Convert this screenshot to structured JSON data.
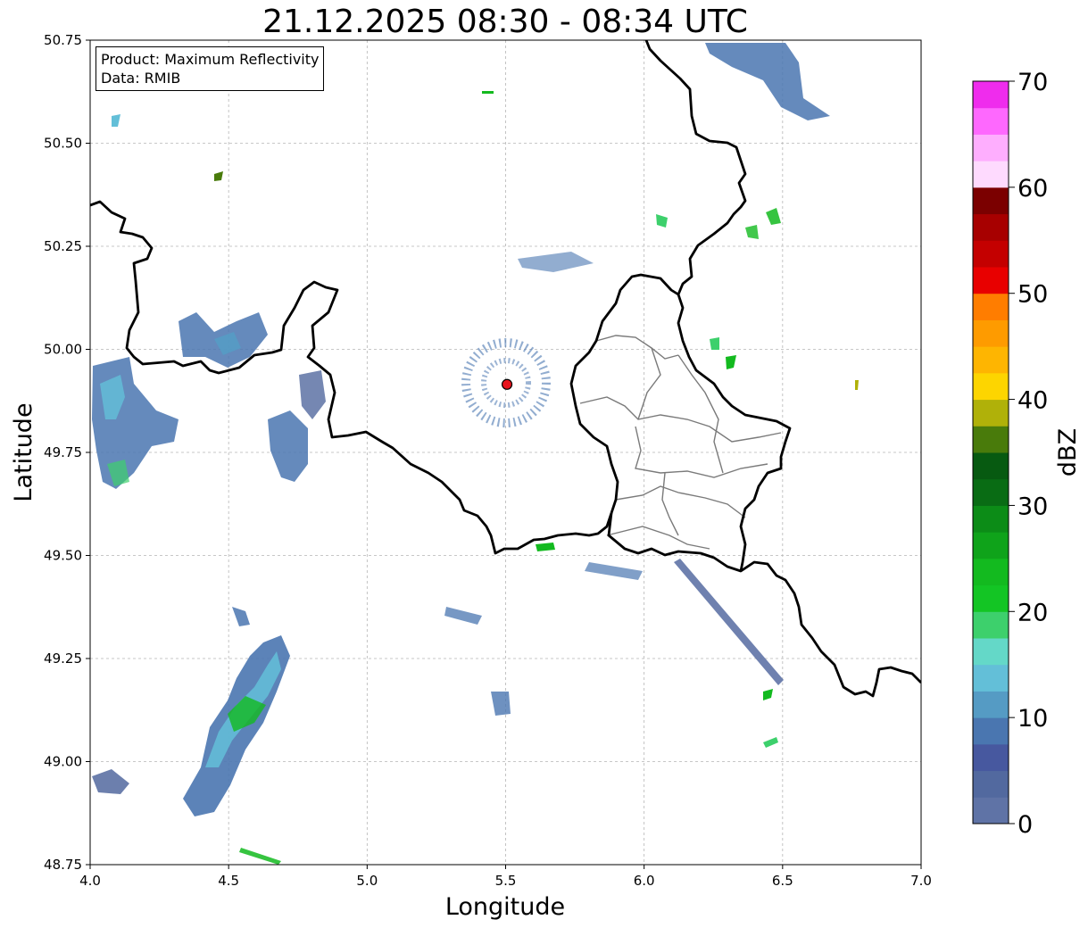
{
  "title": "21.12.2025 08:30 - 08:34 UTC",
  "info_box": {
    "product_line": "Product: Maximum Reflectivity",
    "data_line": "Data: RMIB"
  },
  "axes": {
    "xlabel": "Longitude",
    "ylabel": "Latitude",
    "xlim": [
      4.0,
      7.0
    ],
    "ylim": [
      48.75,
      50.75
    ],
    "xticks": [
      "4.0",
      "4.5",
      "5.0",
      "5.5",
      "6.0",
      "6.5",
      "7.0"
    ],
    "yticks": [
      "48.75",
      "49.00",
      "49.25",
      "49.50",
      "49.75",
      "50.00",
      "50.25",
      "50.50",
      "50.75"
    ],
    "grid": true
  },
  "radar_site": {
    "lon": 5.505,
    "lat": 49.915,
    "color": "#e8141e"
  },
  "colorbar": {
    "label": "dBZ",
    "min": 0,
    "max": 70,
    "ticks": [
      "0",
      "10",
      "20",
      "30",
      "40",
      "50",
      "60",
      "70"
    ],
    "colors": [
      "#5f73a6",
      "#52699f",
      "#47589f",
      "#4a76b0",
      "#559bc4",
      "#63bfd8",
      "#64d8c8",
      "#3dd06c",
      "#13c524",
      "#13ba1f",
      "#0fa31a",
      "#0c8c17",
      "#096c14",
      "#075a11",
      "#497b0b",
      "#b0b109",
      "#fdd500",
      "#feb501",
      "#fe9b00",
      "#ff7d00",
      "#e80000",
      "#c40000",
      "#a70000",
      "#7b0000",
      "#fedafe",
      "#feaefe",
      "#fe68fe",
      "#ef2ced"
    ]
  }
}
